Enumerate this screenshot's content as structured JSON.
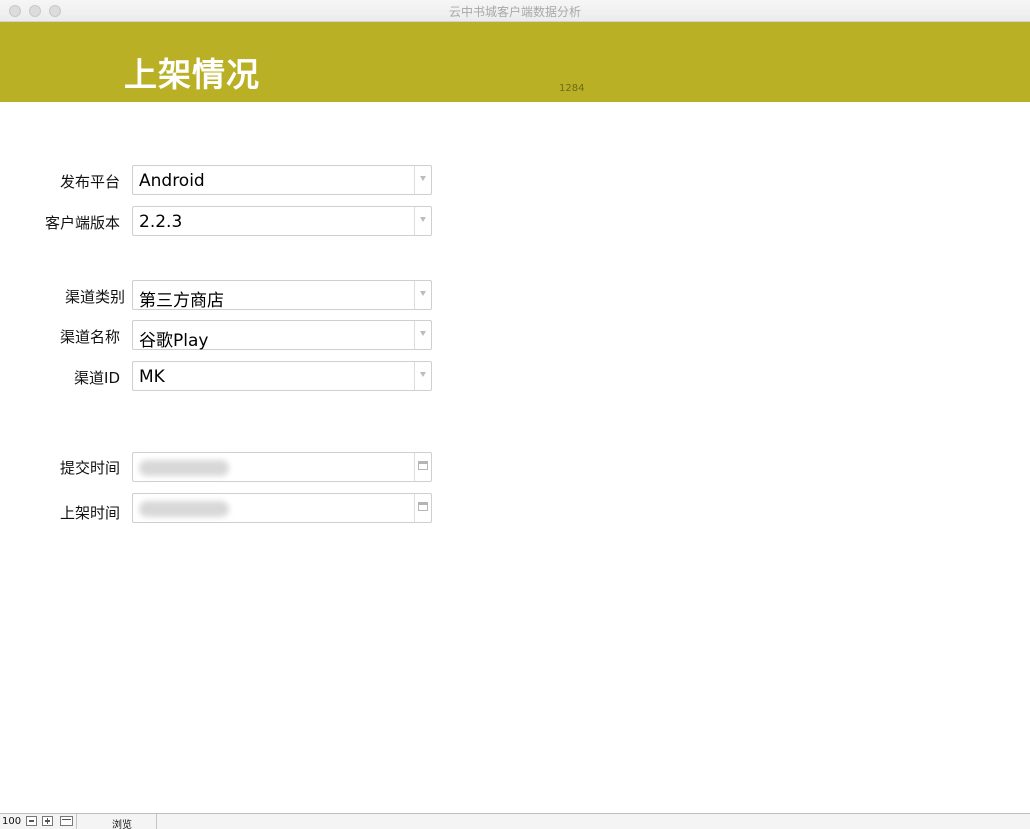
{
  "window": {
    "title": "云中书城客户端数据分析"
  },
  "header": {
    "title": "上架情况",
    "record_number": "1284",
    "color": "#b9b025"
  },
  "form": {
    "platform": {
      "label": "发布平台",
      "value": "Android",
      "control": "dropdown"
    },
    "client_version": {
      "label": "客户端版本",
      "value": "2.2.3",
      "control": "dropdown"
    },
    "channel_type": {
      "label": "渠道类别",
      "value": "第三方商店",
      "control": "dropdown"
    },
    "channel_name": {
      "label": "渠道名称",
      "value": "谷歌Play",
      "control": "dropdown"
    },
    "channel_id": {
      "label": "渠道ID",
      "value": "MK",
      "control": "dropdown"
    },
    "submit_time": {
      "label": "提交时间",
      "value": "",
      "control": "date",
      "redacted": true
    },
    "listing_time": {
      "label": "上架时间",
      "value": "",
      "control": "date",
      "redacted": true
    }
  },
  "statusbar": {
    "zoom": "100",
    "mode": "浏览",
    "icons": [
      "zoom-out-icon",
      "zoom-in-icon",
      "toggle-toolbar-icon"
    ]
  }
}
